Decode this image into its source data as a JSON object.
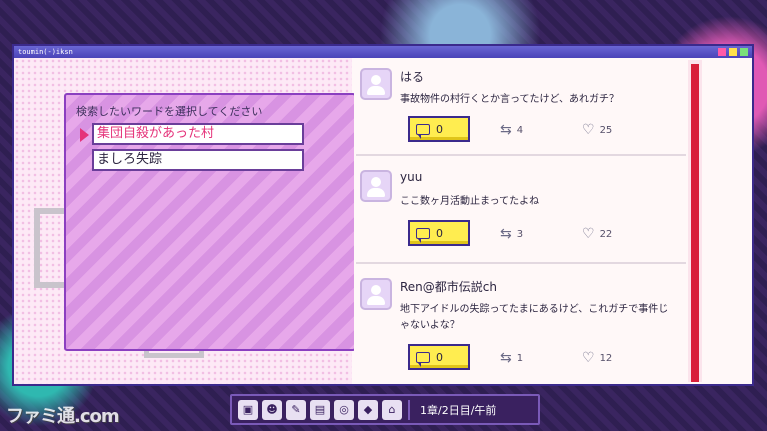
{
  "window": {
    "title": "toumin(-)iksn"
  },
  "search": {
    "prompt": "検索したいワードを選択してください",
    "options": [
      {
        "label": "集団自殺があった村",
        "selected": true
      },
      {
        "label": "ましろ失踪",
        "selected": false
      }
    ]
  },
  "posts": [
    {
      "user": "はる",
      "text": "事故物件の村行くとか言ってたけど、あれガチ？",
      "replies": "0",
      "retweets": "4",
      "likes": "25"
    },
    {
      "user": "yuu",
      "text": "ここ数ヶ月活動止まってたよね",
      "replies": "0",
      "retweets": "3",
      "likes": "22"
    },
    {
      "user": "Ren@都市伝説ch",
      "text": "地下アイドルの失踪ってたまにあるけど、これガチで事件じゃないよな？",
      "replies": "0",
      "retweets": "1",
      "likes": "12"
    }
  ],
  "taskbar": {
    "icons": [
      "package-icon",
      "person-icon",
      "memo-icon",
      "folder-icon",
      "search-globe-icon",
      "map-pin-icon",
      "home-icon"
    ],
    "status": "1章/2日目/午前"
  },
  "watermark": "ファミ通.com",
  "colors": {
    "accent": "#e5337a",
    "scroll": "#d81f3a",
    "button": "#ffed50",
    "frame": "#3b2a8c"
  }
}
